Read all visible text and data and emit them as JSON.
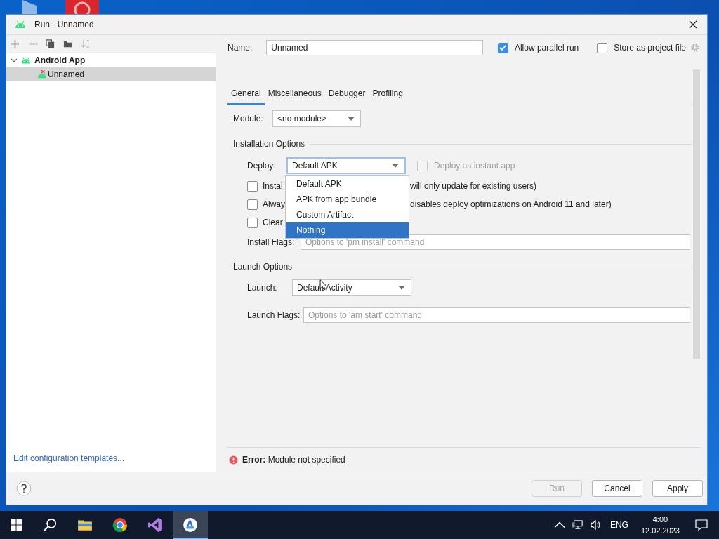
{
  "window": {
    "title": "Run - Unnamed"
  },
  "toolbar": [
    {
      "kind": "add",
      "disabled": false
    },
    {
      "kind": "remove",
      "disabled": false
    },
    {
      "kind": "copy",
      "disabled": false
    },
    {
      "kind": "folder",
      "disabled": false
    },
    {
      "kind": "sort",
      "disabled": true
    }
  ],
  "tree": [
    {
      "label": "Android App",
      "expanded": true,
      "selected": false,
      "children": [
        {
          "label": "Unnamed",
          "selected": true,
          "error": true
        }
      ]
    }
  ],
  "templates_link": "Edit configuration templates...",
  "name_field": {
    "label": "Name:",
    "value": "Unnamed"
  },
  "allow_parallel": {
    "label": "Allow parallel run",
    "checked": true
  },
  "store_project": {
    "label": "Store as project file",
    "checked": false
  },
  "tabs": [
    {
      "label": "General",
      "selected": true
    },
    {
      "label": "Miscellaneous",
      "selected": false
    },
    {
      "label": "Debugger",
      "selected": false
    },
    {
      "label": "Profiling",
      "selected": false
    }
  ],
  "module": {
    "label": "Module:",
    "value": "<no module>"
  },
  "installation": {
    "heading": "Installation Options",
    "deploy": {
      "label": "Deploy:",
      "value": "Default APK"
    },
    "instant": {
      "label": "Deploy as instant app",
      "checked": false,
      "disabled": true
    },
    "options": [
      {
        "checked": false,
        "parts": [
          "Instal",
          "will only update for existing users)"
        ]
      },
      {
        "checked": false,
        "parts": [
          "Alway",
          "disables deploy optimizations on Android 11 and later)"
        ]
      },
      {
        "checked": false,
        "parts": [
          "Clear"
        ]
      }
    ],
    "install_flags": {
      "label": "Install Flags:",
      "placeholder": "Options to 'pm install' command"
    }
  },
  "deploy_menu": [
    {
      "label": "Default APK",
      "selected": false
    },
    {
      "label": "APK from app bundle",
      "selected": false
    },
    {
      "label": "Custom Artifact",
      "selected": false
    },
    {
      "label": "Nothing",
      "selected": true
    }
  ],
  "launch": {
    "heading": "Launch Options",
    "launch": {
      "label": "Launch:",
      "value": "Default Activity"
    },
    "launch_flags": {
      "label": "Launch Flags:",
      "placeholder": "Options to 'am start' command"
    }
  },
  "error": "**Error:** Module not specified",
  "buttons": [
    {
      "label": "Run",
      "disabled": true
    },
    {
      "label": "Cancel",
      "disabled": false
    },
    {
      "label": "Apply",
      "disabled": false
    }
  ],
  "taskbar": {
    "apps": [
      {
        "kind": "search",
        "active": false
      },
      {
        "kind": "folder",
        "active": false
      },
      {
        "kind": "browser",
        "active": false
      },
      {
        "kind": "studio",
        "active": false
      },
      {
        "kind": "android",
        "active": true
      }
    ],
    "language": "ENG",
    "time": "4:00",
    "date": "12.02.2023"
  }
}
